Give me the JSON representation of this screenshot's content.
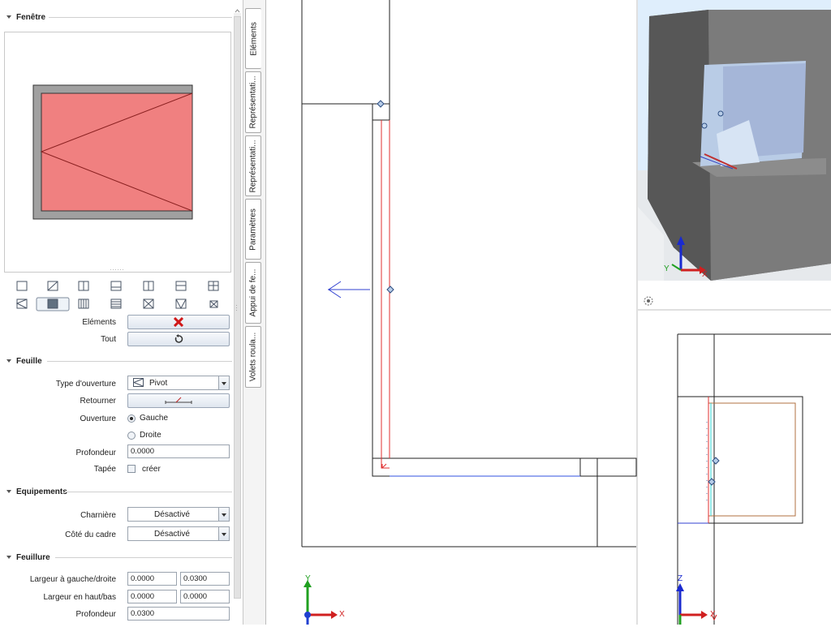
{
  "sections": {
    "fenetre": "Fenêtre",
    "feuille": "Feuille",
    "equipements": "Equipements",
    "feuillure": "Feuillure"
  },
  "fenetre": {
    "elements_label": "Eléments",
    "tout_label": "Tout",
    "preview_fill": "#f08080",
    "frame_color": "#a0a0a0"
  },
  "feuille": {
    "type_ouverture_label": "Type d'ouverture",
    "type_ouverture_value": "Pivot",
    "retourner_label": "Retourner",
    "ouverture_label": "Ouverture",
    "gauche": "Gauche",
    "droite": "Droite",
    "profondeur_label": "Profondeur",
    "profondeur_value": "0.0000",
    "tapee_label": "Tapée",
    "creer": "créer"
  },
  "equipements": {
    "charniere_label": "Charnière",
    "charniere_value": "Désactivé",
    "cote_cadre_label": "Côté du cadre",
    "cote_cadre_value": "Désactivé"
  },
  "feuillure": {
    "largeur_gd_label": "Largeur à gauche/droite",
    "largeur_gd_1": "0.0000",
    "largeur_gd_2": "0.0300",
    "largeur_hb_label": "Largeur en haut/bas",
    "largeur_hb_1": "0.0000",
    "largeur_hb_2": "0.0000",
    "profondeur_label": "Profondeur",
    "profondeur_value": "0.0300"
  },
  "tabs": [
    "Eléments",
    "Représentati...",
    "Représentati...",
    "Paramètres",
    "Appui de fe...",
    "Volets roula..."
  ],
  "axes": {
    "y": "Y",
    "x": "X",
    "z": "Z"
  },
  "colors": {
    "accent": "#2060c0",
    "red": "#e02020",
    "green": "#20a020"
  }
}
